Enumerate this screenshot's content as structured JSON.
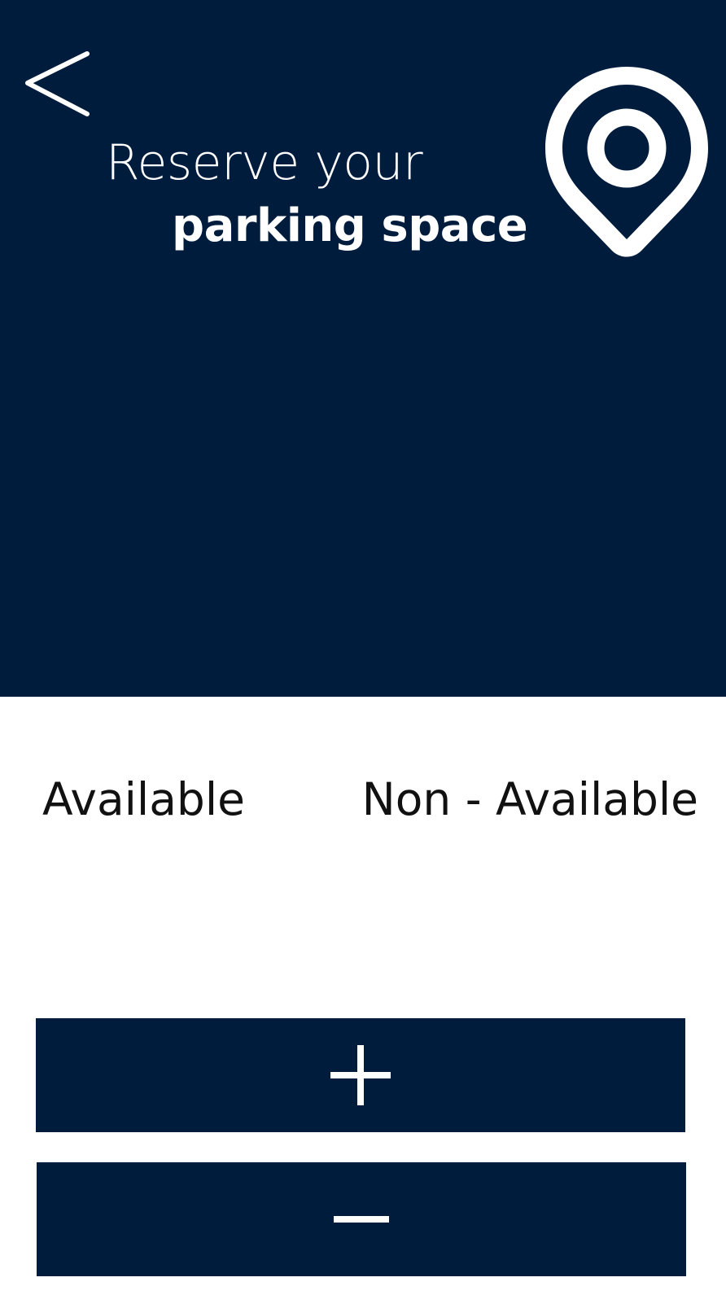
{
  "header": {
    "title_line_1": "Reserve your",
    "title_line_2": "parking space",
    "back_icon": "chevron-left-icon",
    "location_icon": "map-pin-icon"
  },
  "legend": {
    "available": "Available",
    "non_available": "Non - Available"
  },
  "actions": {
    "add_icon": "plus-icon",
    "remove_icon": "minus-icon"
  },
  "colors": {
    "primary": "#001c3d",
    "background": "#ffffff",
    "text_on_primary": "#ffffff",
    "text": "#111111"
  }
}
